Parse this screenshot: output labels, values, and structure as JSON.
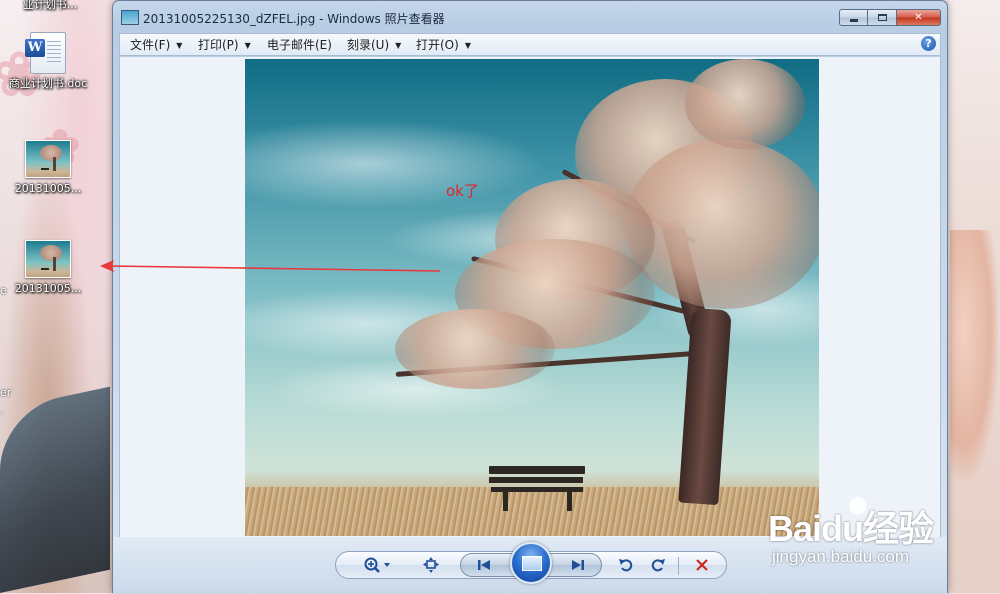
{
  "window": {
    "title": "20131005225130_dZFEL.jpg - Windows 照片查看器",
    "caption": {
      "minimize": "minimize",
      "maximize": "maximize",
      "close": "✕"
    }
  },
  "menu": [
    {
      "label": "文件(F)",
      "has_dropdown": true
    },
    {
      "label": "打印(P)",
      "has_dropdown": true
    },
    {
      "label": "电子邮件(E)",
      "has_dropdown": false
    },
    {
      "label": "刻录(U)",
      "has_dropdown": true
    },
    {
      "label": "打开(O)",
      "has_dropdown": true
    }
  ],
  "help_glyph": "?",
  "annotation": {
    "text": "ok了",
    "color": "#e0262a"
  },
  "desktop": {
    "icons": [
      {
        "label": "业计划书...",
        "type": "doc"
      },
      {
        "label": "商业计划书.doc",
        "type": "doc"
      },
      {
        "label": "20131005...",
        "type": "image"
      },
      {
        "label": "20131005...",
        "type": "image"
      }
    ],
    "edge_chars": [
      "e",
      "er",
      "."
    ]
  },
  "controls": {
    "zoom_icon": "zoom-icon",
    "fit_icon": "fit-window-icon",
    "previous_icon": "previous-icon",
    "slideshow_icon": "slideshow-icon",
    "next_icon": "next-icon",
    "rotate_ccw_icon": "rotate-counterclockwise-icon",
    "rotate_cw_icon": "rotate-clockwise-icon",
    "delete_icon": "delete-icon",
    "delete_color": "#d0281f"
  },
  "watermark": {
    "logo": "Baidu经验",
    "url": "jingyan.baidu.com"
  },
  "colors": {
    "accent": "#1f4f99",
    "arrow": "#e8383b"
  }
}
